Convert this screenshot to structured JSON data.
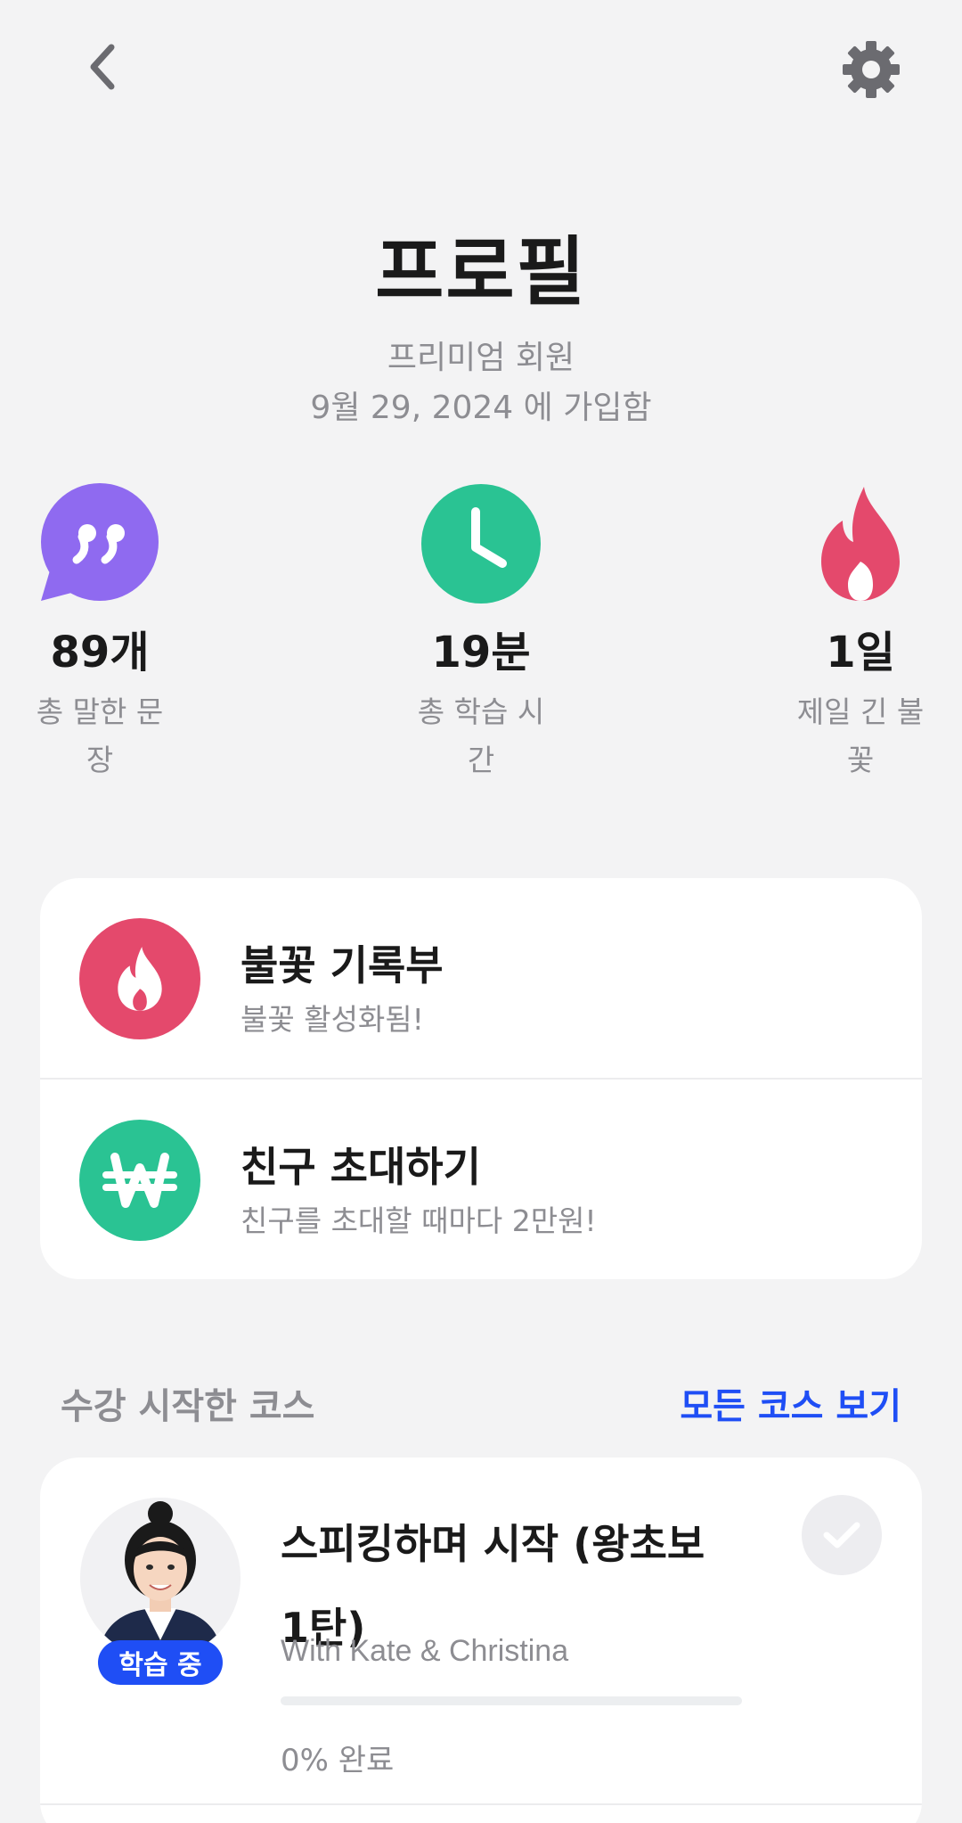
{
  "header": {
    "title": "프로필",
    "membership": "프리미엄 회원",
    "joined": "9월 29, 2024  에 가입함"
  },
  "icons": {
    "back": "chevron-left-icon",
    "settings": "gear-icon"
  },
  "stats": [
    {
      "icon": "quote-bubble-icon",
      "color": "#8f6af0",
      "value": "89개",
      "label": "총 말한 문장"
    },
    {
      "icon": "clock-icon",
      "color": "#2ac393",
      "value": "19분",
      "label": "총 학습 시간"
    },
    {
      "icon": "flame-icon",
      "color": "#e4496c",
      "value": "1일",
      "label": "제일 긴 불꽃"
    }
  ],
  "menu": [
    {
      "icon": "flame-icon",
      "color": "#e4496c",
      "title": "불꽃 기록부",
      "subtitle": "불꽃 활성화됨!"
    },
    {
      "icon": "won-icon",
      "color": "#2ac393",
      "title": "친구 초대하기",
      "subtitle": "친구를 초대할 때마다 2만원!"
    }
  ],
  "courses_section": {
    "title": "수강 시작한 코스",
    "link": "모든 코스 보기"
  },
  "course": {
    "badge": "학습 중",
    "title": "스피킹하며 시작 (왕초보 1탄)",
    "subtitle": "With Kate & Christina",
    "progress_value": 0,
    "progress_text": "0% 완료"
  },
  "colors": {
    "accent_blue": "#1f4ef5",
    "background": "#f3f3f4",
    "muted_text": "#8d8d92"
  }
}
